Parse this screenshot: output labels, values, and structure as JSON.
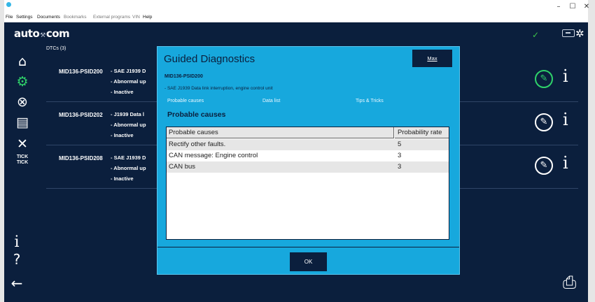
{
  "window": {
    "minimize": "–",
    "maximize": "☐",
    "close": "✕"
  },
  "menu": {
    "file": "File",
    "settings": "Settings",
    "documents": "Documents",
    "bookmarks": "Bookmarks",
    "external_programs": "External programs",
    "vin": "VIN",
    "help": "Help"
  },
  "header": {
    "logo_left": "auto",
    "logo_sep": "⚒",
    "logo_right": "com",
    "status_check": "✓"
  },
  "sidebar": {
    "tick_label_1": "TICK",
    "tick_label_2": "TICK",
    "info": "i",
    "help": "?",
    "back": "←"
  },
  "dtc_list": {
    "header": "DTCs (3)",
    "rows": [
      {
        "code": "MID136-PSID200",
        "line1": "- SAE J1939 D",
        "line2": "- Abnormal up",
        "line3": "- Inactive"
      },
      {
        "code": "MID136-PSID202",
        "line1": "- J1939 Data l",
        "line2": "- Abnormal up",
        "line3": "- Inactive"
      },
      {
        "code": "MID136-PSID208",
        "line1": "- SAE J1939 D",
        "line2": "- Abnormal up",
        "line3": "- Inactive"
      }
    ]
  },
  "modal": {
    "title": "Guided Diagnostics",
    "max_button": "Max",
    "subtitle": "MID136-PSID200",
    "description": "- SAE J1939 Data link interruption, engine control unit",
    "tabs": [
      "Probable causes",
      "Data list",
      "Tips & Tricks"
    ],
    "section_title": "Probable causes",
    "table": {
      "col_cause": "Probable causes",
      "col_prob": "Probability rate",
      "rows": [
        {
          "cause": "Rectify other faults.",
          "rate": "5"
        },
        {
          "cause": "CAN message: Engine control",
          "rate": "3"
        },
        {
          "cause": "CAN bus",
          "rate": "3"
        }
      ]
    },
    "ok_button": "OK"
  },
  "colors": {
    "app_bg": "#0b1f3d",
    "modal_bg": "#17a8dd",
    "accent_green": "#2fd26a"
  },
  "icons": {
    "home": "home-icon",
    "engine": "engine-icon",
    "disabled_engine": "engine-off-icon",
    "document": "document-icon",
    "tools": "tools-icon",
    "compass": "compass-icon",
    "print": "print-icon"
  }
}
